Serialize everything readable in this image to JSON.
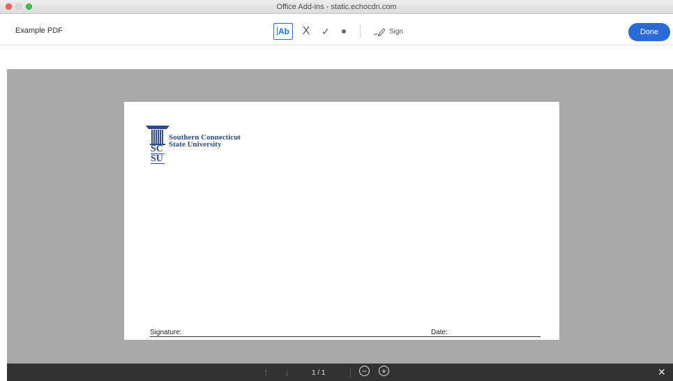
{
  "window": {
    "title": "Office Add-ins - static.echocdn.com"
  },
  "toolbar": {
    "doc_title": "Example PDF",
    "text_tool_label": "Ab",
    "cross_glyph": "X",
    "check_glyph": "✓",
    "sign_label": "Sign",
    "done_label": "Done"
  },
  "document": {
    "logo_line1": "Southern Connecticut",
    "logo_line2": "State University",
    "seal_line1": "SC",
    "seal_line2": "SU",
    "signature_label": "Signature:",
    "date_label": "Date:"
  },
  "footer": {
    "up_glyph": "↑",
    "down_glyph": "↓",
    "page_indicator": "1  / 1",
    "zoom_out_glyph": "−",
    "zoom_in_glyph": "+",
    "close_glyph": "✕"
  },
  "colors": {
    "accent": "#1473e6",
    "done_button": "#2b6bd8",
    "workspace": "#a8a8a8",
    "bottom_bar": "#323232",
    "logo_blue": "#2b4c8c"
  }
}
